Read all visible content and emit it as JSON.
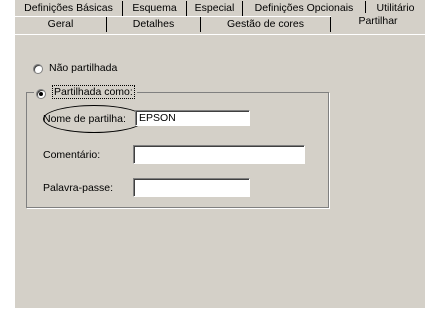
{
  "tabs_row1": [
    {
      "label": "Definições Básicas"
    },
    {
      "label": "Esquema"
    },
    {
      "label": "Especial"
    },
    {
      "label": "Definições Opcionais"
    },
    {
      "label": "Utilitário"
    }
  ],
  "tabs_row2": [
    {
      "label": "Geral"
    },
    {
      "label": "Detalhes"
    },
    {
      "label": "Gestão de cores"
    },
    {
      "label": "Partilhar"
    }
  ],
  "active_tab": "Partilhar",
  "sharing": {
    "not_shared_label": "Não partilhada",
    "shared_as_label": "Partilhada como:",
    "selected_option": "shared_as",
    "share_name_label": "Nome de partilha:",
    "share_name_value": "EPSON",
    "comment_label": "Comentário:",
    "comment_value": "",
    "password_label": "Palavra-passe:",
    "password_value": ""
  },
  "colors": {
    "dialog_bg": "#d4d0c8",
    "highlight": "#ffffff",
    "shadow": "#808080"
  }
}
